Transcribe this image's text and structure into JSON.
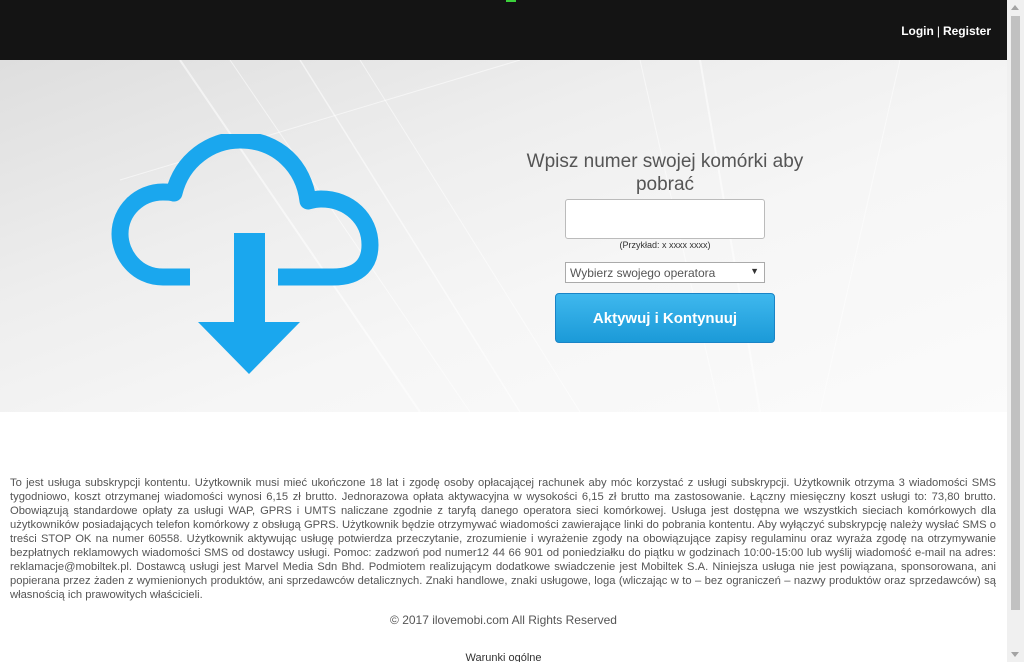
{
  "header": {
    "login_label": "Login",
    "separator": "|",
    "register_label": "Register"
  },
  "form": {
    "title": "Wpisz numer swojej komórki aby pobrać",
    "phone_value": "",
    "phone_placeholder": "",
    "hint": "(Przykład: x xxxx xxxx)",
    "operator_selected": "Wybierz swojego operatora",
    "submit_label": "Aktywuj i Kontynuuj"
  },
  "terms": "To jest usługa subskrypcji kontentu. Użytkownik musi mieć ukończone 18 lat i zgodę osoby opłacającej rachunek aby móc korzystać z usługi subskrypcji. Użytkownik otrzyma 3 wiadomości SMS tygodniowo, koszt otrzymanej wiadomości wynosi 6,15 zł brutto. Jednorazowa opłata aktywacyjna w wysokości 6,15 zł brutto ma zastosowanie. Łączny miesięczny koszt usługi to: 73,80 brutto. Obowiązują standardowe opłaty za usługi WAP, GPRS i UMTS naliczane zgodnie z taryfą danego operatora sieci komórkowej. Usługa jest dostępna we wszystkich sieciach komórkowych dla użytkowników posiadających telefon komórkowy z obsługą GPRS. Użytkownik będzie otrzymywać wiadomości zawierające linki do pobrania kontentu. Aby wyłączyć subskrypcję należy wysłać SMS o treści STOP OK na numer 60558. Użytkownik aktywując usługę potwierdza przeczytanie, zrozumienie i wyrażenie zgody na obowiązujące zapisy regulaminu oraz wyraża zgodę na otrzymywanie bezpłatnych reklamowych wiadomości SMS od dostawcy usługi. Pomoc: zadzwoń pod numer12 44 66 901 od poniedziałku do piątku w godzinach 10:00-15:00 lub wyślij wiadomość e-mail na adres: reklamacje@mobiltek.pl. Dostawcą usługi jest Marvel Media Sdn Bhd. Podmiotem realizującym dodatkowe swiadczenie jest Mobiltek S.A. Niniejsza usługa nie jest powiązana, sponsorowana, ani popierana przez żaden z wymienionych produktów, ani sprzedawców detalicznych. Znaki handlowe, znaki usługowe, loga (wliczając w to – bez ograniczeń – nazwy produktów oraz sprzedawców) są własnością ich prawowitych właścicieli.",
  "copyright": "© 2017 ilovemobi.com   All Rights Reserved",
  "footer_link": "Warunki ogólne",
  "colors": {
    "header_bg": "#141414",
    "accent_blue": "#1b9ad8",
    "cloud_blue": "#1aa7ee"
  },
  "icons": {
    "hero": "cloud-download-icon",
    "select_arrow": "triangle-down-icon"
  }
}
